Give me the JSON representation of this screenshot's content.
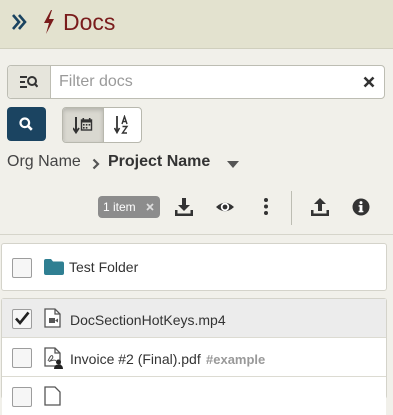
{
  "app": {
    "title": "Docs",
    "accent_color": "#7a1c1c",
    "header_bg": "#e3e2cf",
    "primary_button_color": "#1b4461"
  },
  "filter": {
    "placeholder": "Filter docs",
    "value": ""
  },
  "sort": {
    "active": "date",
    "options": [
      "date",
      "alpha"
    ]
  },
  "breadcrumb": {
    "org": "Org Name",
    "project": "Project Name"
  },
  "toolbar": {
    "selection_count": "1 item",
    "icons": [
      "download-icon",
      "eye-icon",
      "more-vertical-icon",
      "upload-icon",
      "info-icon"
    ]
  },
  "folders": [
    {
      "name": "Test Folder",
      "icon": "folder-icon",
      "checked": false
    }
  ],
  "files": [
    {
      "name": "DocSectionHotKeys.mp4",
      "icon": "video-file-icon",
      "checked": true,
      "tag": ""
    },
    {
      "name": "Invoice #2 (Final).pdf",
      "icon": "pdf-user-file-icon",
      "checked": false,
      "tag": "#example"
    }
  ]
}
